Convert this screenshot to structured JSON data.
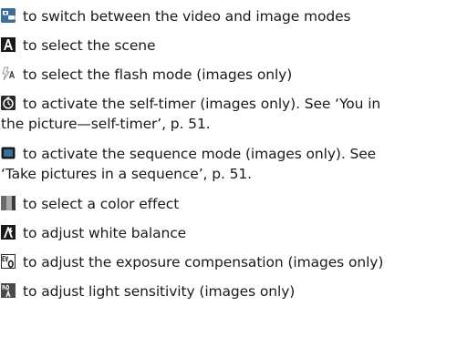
{
  "items": [
    {
      "icon": "video-image-mode-icon",
      "text": "to switch between the video and image modes"
    },
    {
      "icon": "scene-icon",
      "text": "to select the scene"
    },
    {
      "icon": "flash-mode-icon",
      "text": "to select the flash mode (images only)"
    },
    {
      "icon": "self-timer-icon",
      "text": "to activate the self-timer (images only). See ‘You in",
      "text2": "the picture—self-timer’, p. 51."
    },
    {
      "icon": "sequence-mode-icon",
      "text": "to activate the sequence mode (images only). See",
      "text2": "‘Take pictures in a sequence’, p. 51."
    },
    {
      "icon": "color-effect-icon",
      "text": "to select a color effect"
    },
    {
      "icon": "white-balance-icon",
      "text": "to adjust white balance"
    },
    {
      "icon": "exposure-compensation-icon",
      "text": "to adjust the exposure compensation (images only)"
    },
    {
      "icon": "light-sensitivity-icon",
      "text": "to adjust light sensitivity (images only)"
    }
  ]
}
